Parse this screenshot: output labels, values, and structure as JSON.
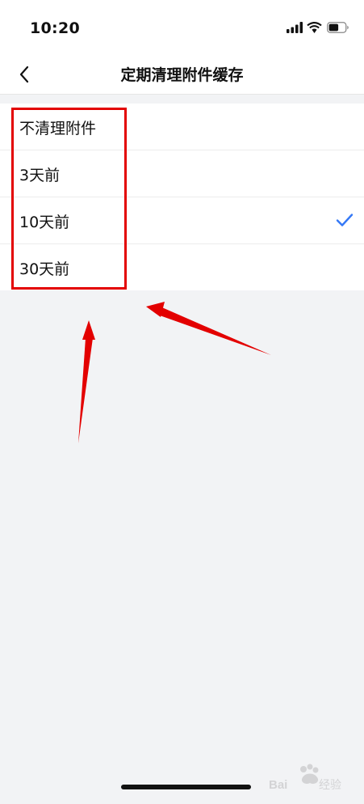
{
  "status_bar": {
    "time": "10:20",
    "icons": [
      "signal-icon",
      "wifi-icon",
      "battery-icon"
    ]
  },
  "nav": {
    "back_icon": "chevron-left-icon",
    "title": "定期清理附件缓存"
  },
  "options": [
    {
      "label": "不清理附件",
      "selected": false
    },
    {
      "label": "3天前",
      "selected": false
    },
    {
      "label": "10天前",
      "selected": true
    },
    {
      "label": "30天前",
      "selected": false
    }
  ],
  "colors": {
    "accent": "#3478f6",
    "annotation": "#e30000",
    "background": "#f2f3f5",
    "surface": "#ffffff"
  },
  "watermark": {
    "text": "Bai经验"
  }
}
